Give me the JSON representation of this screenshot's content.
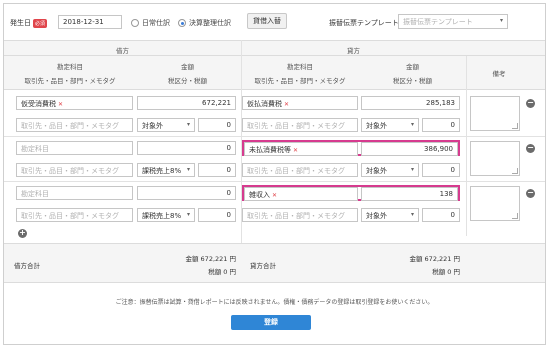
{
  "top": {
    "date_label": "発生日",
    "required_badge": "必須",
    "date_value": "2018-12-31",
    "radio_normal": "日常仕訳",
    "radio_settlement": "決算整理仕訳",
    "swap_button": "貸借入替",
    "template_label": "振替伝票テンプレート",
    "template_placeholder": "振替伝票テンプレート"
  },
  "headers": {
    "debit": "借方",
    "credit": "貸方",
    "account_line1": "勘定科目",
    "account_line2": "取引先・品目・部門・メモタグ",
    "amount_line1": "金額",
    "amount_line2": "税区分・税額",
    "memo": "備考"
  },
  "rows": [
    {
      "debit_account": "仮受消費税",
      "debit_amount": "672,221",
      "debit_tax": "対象外",
      "debit_tax_amount": "0",
      "credit_account": "仮払消費税",
      "credit_amount": "285,183",
      "credit_tax": "対象外",
      "credit_tax_amount": "0"
    },
    {
      "debit_account": "勘定科目",
      "debit_amount": "0",
      "debit_tax": "課税売上8%",
      "debit_tax_amount": "0",
      "credit_account": "未払消費税等",
      "credit_amount": "386,900",
      "credit_tax": "対象外",
      "credit_tax_amount": "0"
    },
    {
      "debit_account": "勘定科目",
      "debit_amount": "0",
      "debit_tax": "課税売上8%",
      "debit_tax_amount": "0",
      "credit_account": "雑収入",
      "credit_amount": "138",
      "credit_tax": "対象外",
      "credit_tax_amount": "0"
    }
  ],
  "tags_placeholder": "取引先・品目・部門・メモタグ",
  "totals": {
    "debit_label": "借方合計",
    "debit_amount": "金額 672,221 円",
    "debit_tax": "税額 0 円",
    "credit_label": "貸方合計",
    "credit_amount": "金額 672,221 円",
    "credit_tax": "税額 0 円"
  },
  "notice": "ご注意：振替伝票は試算・貸借レポートには反映されません。債権・債務データの登録は取引登録をお使いください。",
  "submit_label": "登録",
  "colors": {
    "accent": "#2f86d6",
    "highlight": "#d63b8f",
    "required": "#e0454b"
  }
}
